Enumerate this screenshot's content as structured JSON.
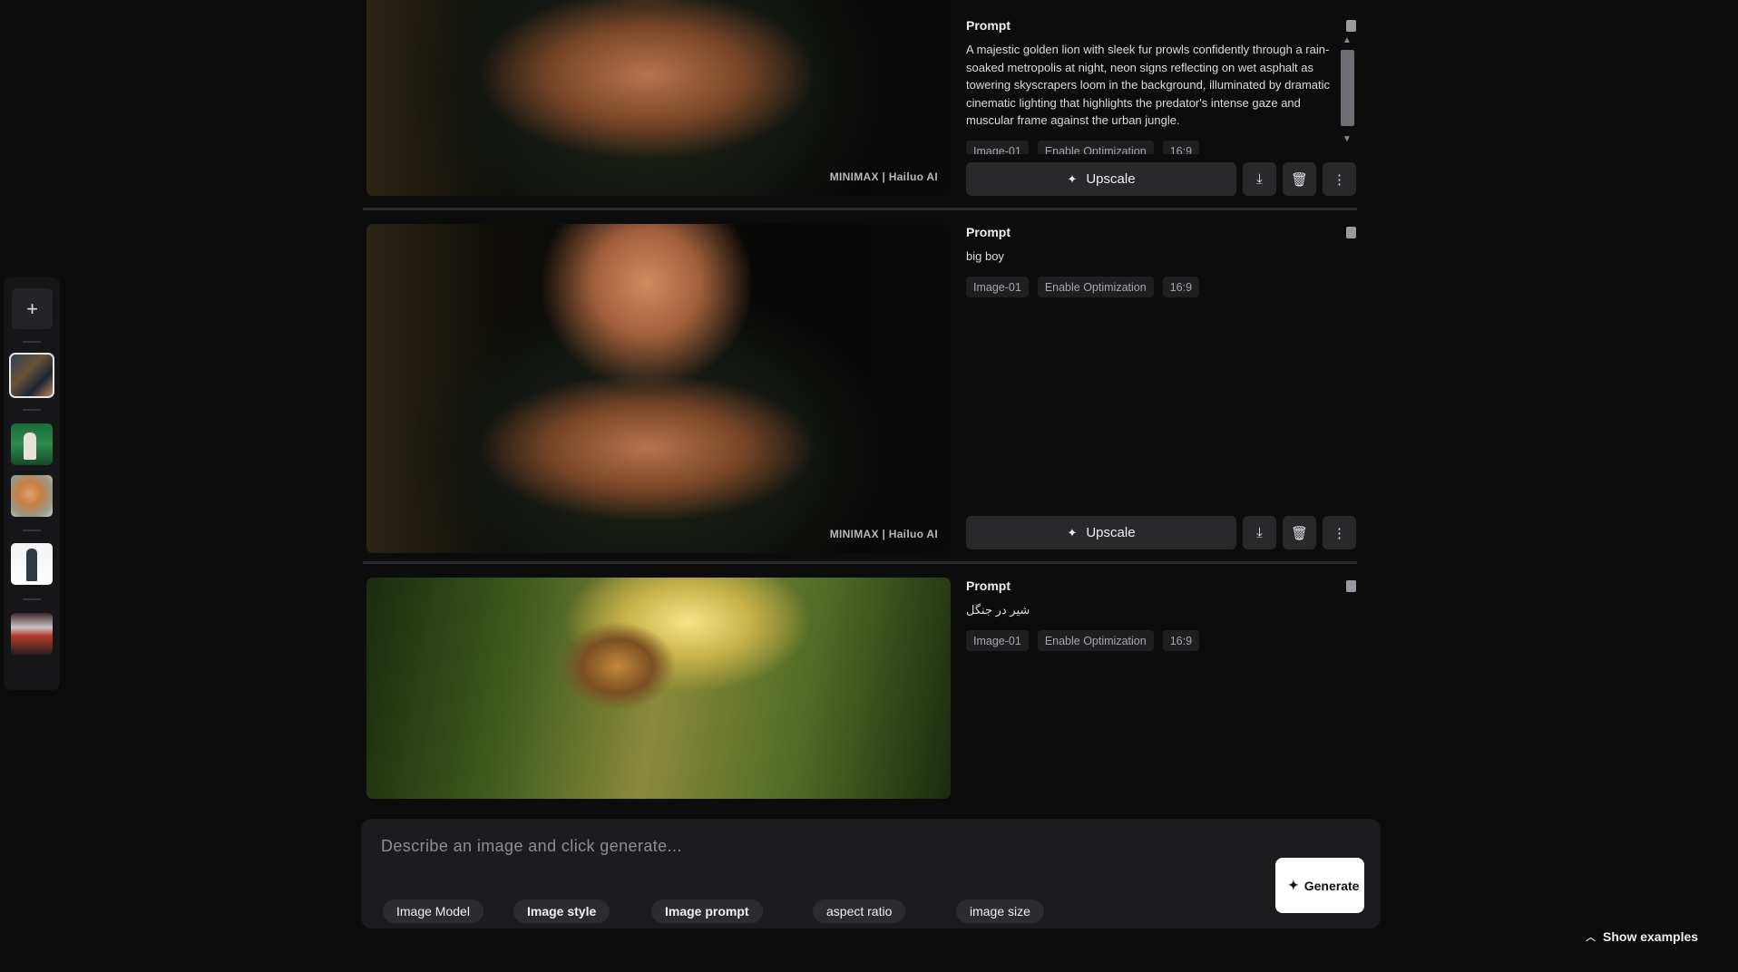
{
  "rail": {
    "new_label": "+",
    "thumbnails": [
      "session-1",
      "session-2",
      "session-3",
      "session-4",
      "session-5"
    ]
  },
  "items": [
    {
      "prompt_label": "Prompt",
      "prompt_text": "A majestic golden lion with sleek fur prowls confidently through a rain-soaked metropolis at night, neon signs reflecting on wet asphalt as towering skyscrapers loom in the background, illuminated by dramatic cinematic lighting that highlights the predator's intense gaze and muscular frame against the urban jungle.",
      "tags": [
        "Image-01",
        "Enable Optimization",
        "16:9"
      ],
      "watermark": "MINIMAX | Hailuo AI",
      "upscale_label": "Upscale"
    },
    {
      "prompt_label": "Prompt",
      "prompt_text": "big boy",
      "tags": [
        "Image-01",
        "Enable Optimization",
        "16:9"
      ],
      "watermark": "MINIMAX | Hailuo AI",
      "upscale_label": "Upscale"
    },
    {
      "prompt_label": "Prompt",
      "prompt_text": "شیر در جنگل",
      "tags": [
        "Image-01",
        "Enable Optimization",
        "16:9"
      ]
    }
  ],
  "composer": {
    "placeholder": "Describe an image and click generate...",
    "generate_label": "Generate",
    "chips": [
      "Image Model",
      "Image style",
      "Image prompt",
      "aspect ratio",
      "image size"
    ]
  },
  "show_examples_label": "Show examples",
  "icons": {
    "upscale": "sparkle-icon",
    "download": "download-icon",
    "delete": "trash-icon",
    "more": "more-vertical-icon",
    "copy": "copy-icon",
    "generate": "sparkles-icon",
    "chevron": "chevron-up-icon"
  }
}
